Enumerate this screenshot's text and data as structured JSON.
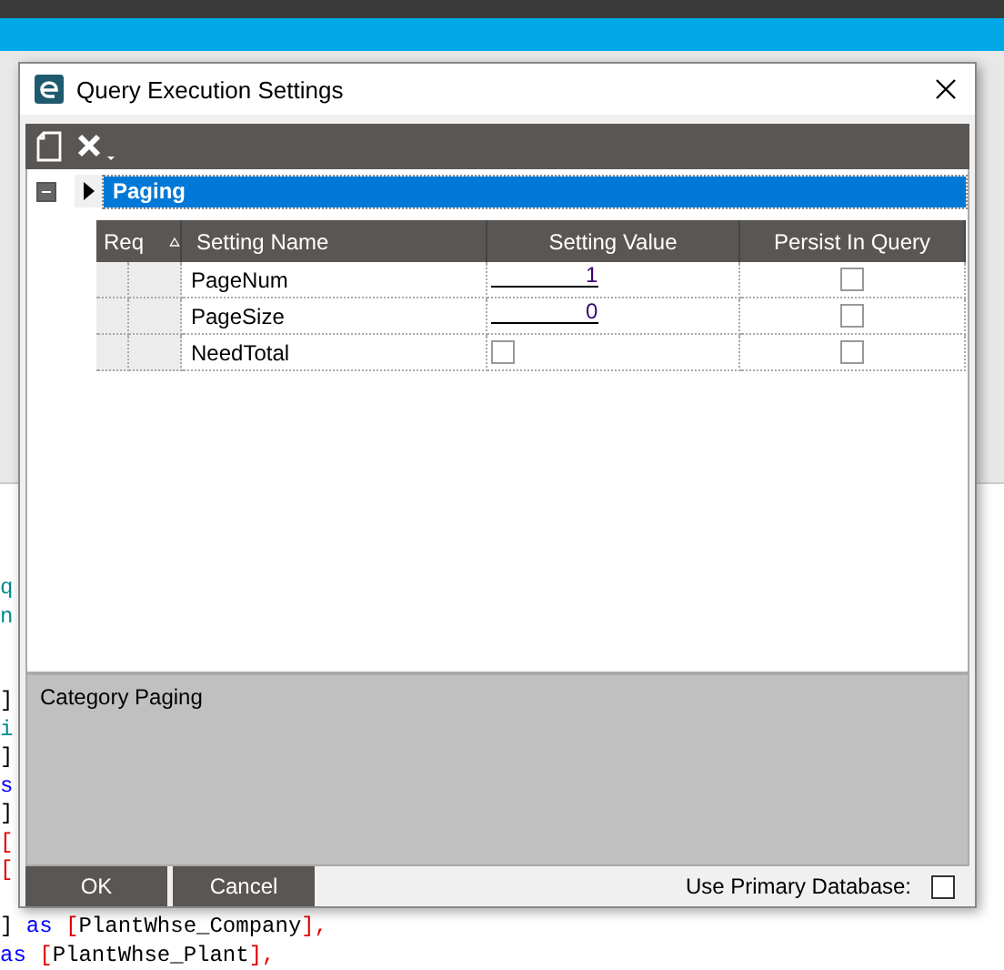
{
  "code_lines": [
    {
      "kind": "text",
      "tokens": [
        {
          "kind": "ident",
          "text": "q"
        }
      ]
    },
    {
      "kind": "text",
      "tokens": [
        {
          "kind": "ident",
          "text": "n"
        }
      ]
    },
    {
      "kind": "blank"
    },
    {
      "kind": "blank"
    },
    {
      "kind": "text",
      "tokens": [
        {
          "kind": "plain",
          "text": "]"
        }
      ]
    },
    {
      "kind": "text",
      "tokens": [
        {
          "kind": "ident",
          "text": "i"
        }
      ]
    },
    {
      "kind": "text",
      "tokens": [
        {
          "kind": "plain",
          "text": "]"
        }
      ]
    },
    {
      "kind": "text",
      "tokens": [
        {
          "kind": "keyword",
          "text": "s"
        }
      ]
    },
    {
      "kind": "text",
      "tokens": [
        {
          "kind": "plain",
          "text": "]"
        }
      ]
    },
    {
      "kind": "text",
      "tokens": [
        {
          "kind": "bracket",
          "text": "["
        }
      ]
    },
    {
      "kind": "text",
      "tokens": [
        {
          "kind": "bracket",
          "text": "["
        }
      ]
    },
    {
      "kind": "blank"
    },
    {
      "kind": "text",
      "tokens": [
        {
          "kind": "plain",
          "text": "] "
        },
        {
          "kind": "keyword",
          "text": "as "
        },
        {
          "kind": "bracket",
          "text": "["
        },
        {
          "kind": "plain",
          "text": "PlantWhse_Company"
        },
        {
          "kind": "bracket",
          "text": "],"
        }
      ]
    },
    {
      "kind": "text",
      "tokens": [
        {
          "kind": "keyword",
          "text": "as "
        },
        {
          "kind": "bracket",
          "text": "["
        },
        {
          "kind": "plain",
          "text": "PlantWhse_Plant"
        },
        {
          "kind": "bracket",
          "text": "],"
        }
      ]
    }
  ],
  "dialog": {
    "title": "Query Execution Settings",
    "group": {
      "label": "Paging",
      "expanded": true,
      "selected": true
    },
    "columns": [
      "Req",
      "Setting Name",
      "Setting Value",
      "Persist In Query"
    ],
    "rows": [
      {
        "name": "PageNum",
        "kind": "text",
        "value": "1",
        "persist": false
      },
      {
        "name": "PageSize",
        "kind": "text",
        "value": "0",
        "persist": false
      },
      {
        "name": "NeedTotal",
        "kind": "checkbox",
        "checked": false,
        "persist": false
      }
    ],
    "description": "Category Paging",
    "buttons": [
      "OK",
      "Cancel"
    ],
    "use_primary_database": {
      "label": "Use Primary Database:",
      "checked": false
    }
  }
}
